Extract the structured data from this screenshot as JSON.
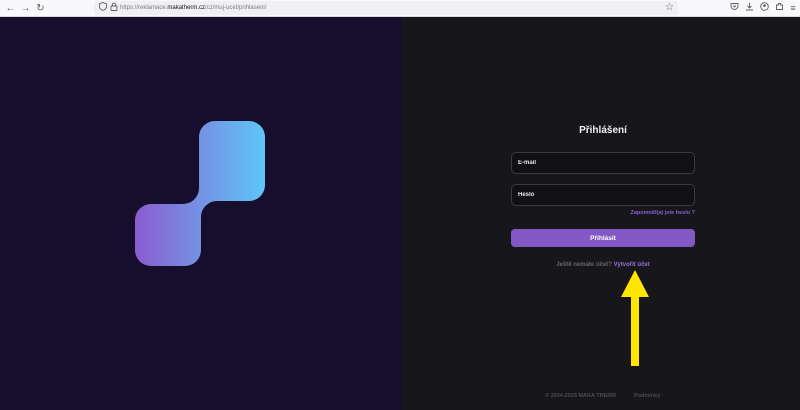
{
  "browser": {
    "url_prefix": "https://reklamace.",
    "url_domain": "makatherm.cz",
    "url_path": "/cz/muj-ucet/prihlaseni/"
  },
  "login": {
    "title": "Přihlášení",
    "email_placeholder": "E-mail",
    "password_placeholder": "Heslo",
    "forgot_label": "Zapomněl(a) jste heslo ?",
    "submit_label": "Přihlásit",
    "signup_prompt": "Ještě nemáte účet?",
    "signup_link": "Vytvořit účet"
  },
  "footer": {
    "copyright": "© 2024-2025 MAKA THERM",
    "terms_link": "Podmínky"
  },
  "colors": {
    "left_bg": "#170e2d",
    "right_bg": "#17171b",
    "accent": "#8258c4",
    "logo_gradient_start": "#8a5cd0",
    "logo_gradient_end": "#5ec6f7",
    "arrow": "#ffe600"
  },
  "icons": {
    "back": "arrow-left-icon",
    "forward": "arrow-right-icon",
    "reload": "reload-icon",
    "shield": "shield-icon",
    "lock": "lock-icon",
    "bookmark": "star-icon",
    "pocket": "pocket-icon",
    "download": "download-icon",
    "account": "account-icon",
    "extensions": "extensions-icon",
    "menu": "hamburger-menu-icon"
  }
}
